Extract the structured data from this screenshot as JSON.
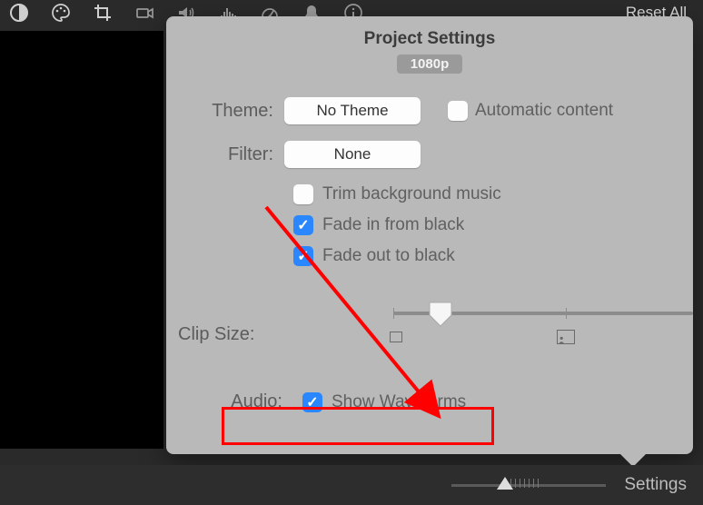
{
  "toolbar": {
    "reset": "Reset All"
  },
  "popover": {
    "title": "Project Settings",
    "resolution": "1080p",
    "theme_label": "Theme:",
    "theme_value": "No Theme",
    "autocontent_label": "Automatic content",
    "filter_label": "Filter:",
    "filter_value": "None",
    "trim_label": "Trim background music",
    "fadein_label": "Fade in from black",
    "fadeout_label": "Fade out to black",
    "clipsize_label": "Clip Size:",
    "audio_label": "Audio:",
    "waveforms_label": "Show Waveforms"
  },
  "bottom": {
    "settings": "Settings"
  }
}
